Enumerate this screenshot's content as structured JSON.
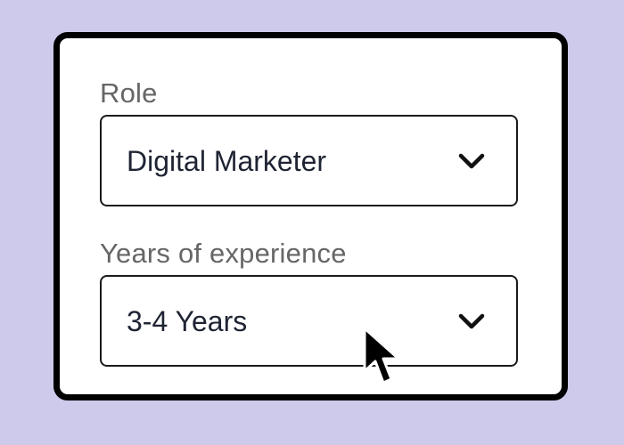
{
  "form": {
    "role": {
      "label": "Role",
      "value": "Digital Marketer"
    },
    "experience": {
      "label": "Years of experience",
      "value": "3-4 Years"
    }
  },
  "icons": {
    "dropdown": "chevron-down-icon",
    "pointer": "mouse-pointer-icon"
  },
  "colors": {
    "background": "#cdcaec",
    "card": "#ffffff",
    "border": "#000000",
    "label_text": "#666666",
    "value_text": "#1f2433"
  }
}
